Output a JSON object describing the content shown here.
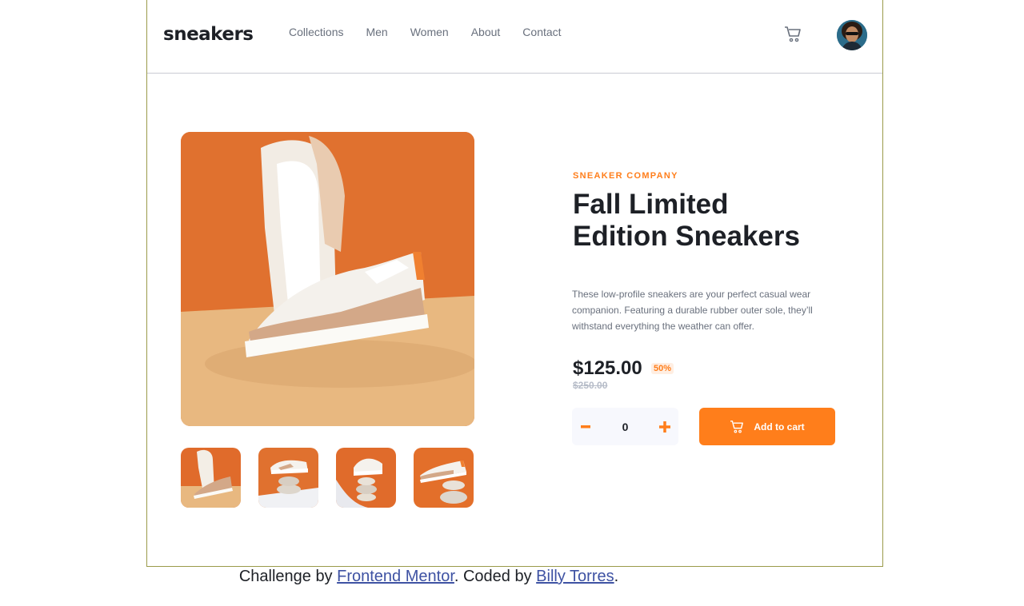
{
  "header": {
    "logo": "sneakers",
    "nav": [
      "Collections",
      "Men",
      "Women",
      "About",
      "Contact"
    ]
  },
  "product": {
    "company": "SNEAKER COMPANY",
    "title": "Fall Limited Edition Sneakers",
    "description": "These low-profile sneakers are your perfect casual wear companion. Featuring a durable rubber outer sole, they’ll withstand everything the weather can offer.",
    "price": "$125.00",
    "discount": "50%",
    "old_price": "$250.00",
    "quantity": "0",
    "add_to_cart": "Add to cart"
  },
  "attribution": {
    "prefix": "Challenge by ",
    "link1": "Frontend Mentor",
    "middle": ". Coded by ",
    "link2": "Billy Torres",
    "suffix": "."
  },
  "colors": {
    "accent": "#ff7e1b",
    "dark": "#1d2026",
    "grey": "#69707d"
  },
  "icons": [
    "cart-icon",
    "avatar",
    "minus-icon",
    "plus-icon"
  ]
}
